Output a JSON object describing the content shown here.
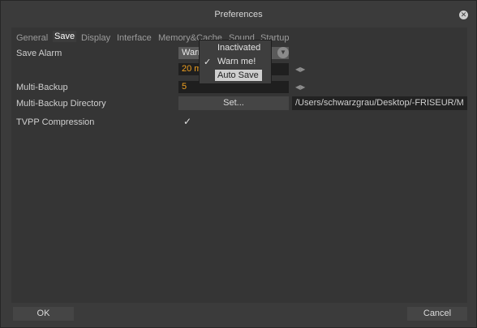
{
  "window": {
    "title": "Preferences"
  },
  "tabs": [
    "General",
    "Save",
    "Display",
    "Interface",
    "Memory&Cache",
    "Sound",
    "Startup"
  ],
  "active_tab": "Save",
  "settings": {
    "save_alarm": {
      "label": "Save Alarm",
      "value": "Warn me!",
      "interval": "20 m"
    },
    "multi_backup": {
      "label": "Multi-Backup",
      "value": "5"
    },
    "multi_backup_dir": {
      "label": "Multi-Backup Directory",
      "button": "Set...",
      "path": "/Users/schwarzgrau/Desktop/-FRISEUR/M"
    },
    "tvpp_compression": {
      "label": "TVPP Compression",
      "checked": true
    }
  },
  "dropdown_menu": {
    "items": [
      {
        "label": "Inactivated",
        "checked": false,
        "highlighted": false
      },
      {
        "label": "Warn me!",
        "checked": true,
        "highlighted": false
      },
      {
        "label": "Auto Save",
        "checked": false,
        "highlighted": true
      }
    ]
  },
  "buttons": {
    "ok": "OK",
    "cancel": "Cancel"
  },
  "colors": {
    "accent_value": "#f0a020",
    "background": "#3b3b3b"
  }
}
